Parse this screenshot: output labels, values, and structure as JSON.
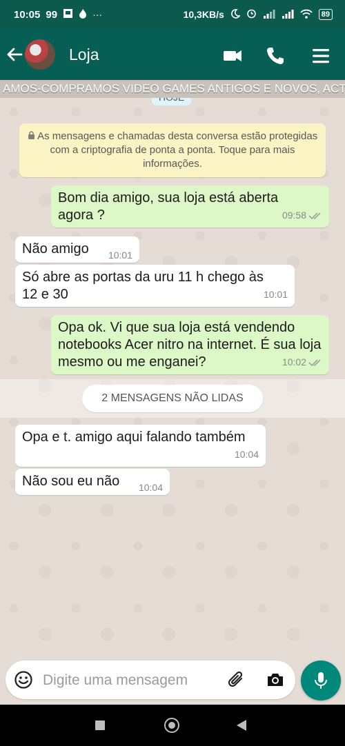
{
  "statusbar": {
    "time": "10:05",
    "left_badge": "99",
    "more": "···",
    "speed": "10,3KB/s",
    "battery": "89",
    "icons": [
      "gallery-icon",
      "flame-icon",
      "moon-icon",
      "alarm-icon",
      "signal-icon",
      "signal-icon",
      "wifi-icon",
      "battery-icon"
    ]
  },
  "header": {
    "title": "Loja",
    "icons": [
      "arrow-left-icon",
      "video-call-icon",
      "phone-icon",
      "menu-icon"
    ]
  },
  "ticker": {
    "text": "AMOS-COMPRAMOS  VIDEO GAMES ANTIGOS E NOVOS, ACTIO"
  },
  "chat": {
    "date_chip": "HOJE",
    "encryption_notice": "As mensagens e chamadas desta conversa estão protegidas com a criptografia de ponta a ponta. Toque para mais informações.",
    "messages": [
      {
        "direction": "out",
        "text": "Bom dia amigo, sua loja está aberta agora ?",
        "time": "09:58",
        "read": true
      },
      {
        "direction": "in",
        "text": "Não amigo",
        "time": "10:01"
      },
      {
        "direction": "in",
        "text": "Só abre as portas da uru 11 h chego às 12 e 30",
        "time": "10:01"
      },
      {
        "direction": "out",
        "text": "Opa ok. Vi que sua loja está vendendo notebooks Acer nitro na internet. É sua loja mesmo ou me enganei?",
        "time": "10:02",
        "read": true
      },
      {
        "direction": "in",
        "text": "Opa e t. amigo aqui falando também",
        "time": "10:04"
      },
      {
        "direction": "in",
        "text": "Não sou eu não",
        "time": "10:04"
      }
    ],
    "unread_banner": "2 MENSAGENS NÃO LIDAS"
  },
  "composer": {
    "placeholder": "Digite uma mensagem",
    "icons": [
      "emoji-icon",
      "attach-icon",
      "camera-icon",
      "mic-icon"
    ]
  },
  "colors": {
    "header": "#075e54",
    "status_bar": "#0b5a4d",
    "outgoing_bubble": "#dcf8c6",
    "incoming_bubble": "#ffffff",
    "encryption_bg": "#fdf4c5",
    "mic_button": "#00897b",
    "read_ticks": "#9aa5a0"
  }
}
